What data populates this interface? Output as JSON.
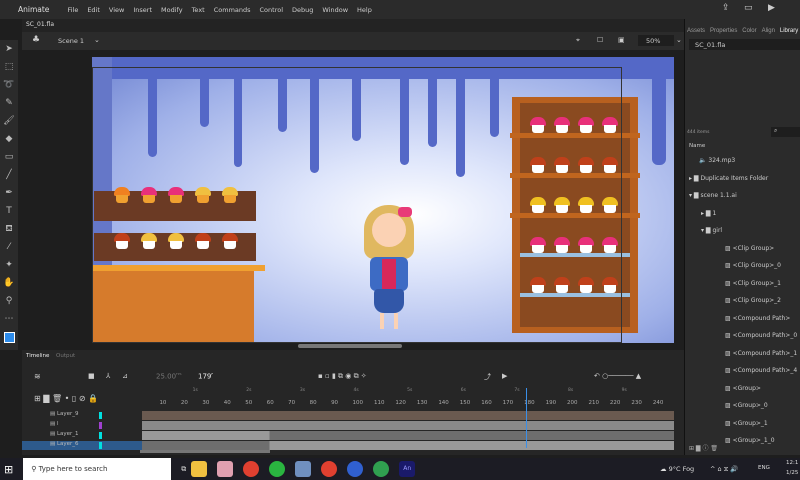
{
  "app": {
    "name": "Animate",
    "menu": [
      "File",
      "Edit",
      "View",
      "Insert",
      "Modify",
      "Text",
      "Commands",
      "Control",
      "Debug",
      "Window",
      "Help"
    ]
  },
  "document": {
    "tab": "SC_01.fla",
    "scene": "Scene 1",
    "zoom": "50%"
  },
  "right_panel": {
    "tabs": [
      "Assets",
      "Properties",
      "Color",
      "Align",
      "Library"
    ],
    "library_doc": "SC_01.fla",
    "item_count": "444 items",
    "name_header": "Name",
    "items": [
      {
        "label": "324.mp3",
        "depth": 0,
        "type": "sound"
      },
      {
        "label": "Duplicate Items Folder",
        "depth": 0,
        "type": "folder-collapsed"
      },
      {
        "label": "scene 1.1.ai",
        "depth": 0,
        "type": "folder-expanded"
      },
      {
        "label": "1",
        "depth": 1,
        "type": "folder-collapsed"
      },
      {
        "label": "girl",
        "depth": 1,
        "type": "folder-expanded"
      },
      {
        "label": "<Clip Group>",
        "depth": 2,
        "type": "graphic"
      },
      {
        "label": "<Clip Group>_0",
        "depth": 2,
        "type": "graphic"
      },
      {
        "label": "<Clip Group>_1",
        "depth": 2,
        "type": "graphic"
      },
      {
        "label": "<Clip Group>_2",
        "depth": 2,
        "type": "graphic"
      },
      {
        "label": "<Compound Path>",
        "depth": 2,
        "type": "graphic"
      },
      {
        "label": "<Compound Path>_0",
        "depth": 2,
        "type": "graphic"
      },
      {
        "label": "<Compound Path>_1",
        "depth": 2,
        "type": "graphic"
      },
      {
        "label": "<Compound Path>_4",
        "depth": 2,
        "type": "graphic"
      },
      {
        "label": "<Group>",
        "depth": 2,
        "type": "graphic"
      },
      {
        "label": "<Group>_0",
        "depth": 2,
        "type": "graphic"
      },
      {
        "label": "<Group>_1",
        "depth": 2,
        "type": "graphic"
      },
      {
        "label": "<Group>_1_0",
        "depth": 2,
        "type": "graphic"
      }
    ]
  },
  "timeline": {
    "tabs": [
      "Timeline",
      "Output"
    ],
    "fps": "25.00",
    "fps_unit": "FPS",
    "frame": "179",
    "frame_unit": "F",
    "seconds": [
      "1s",
      "2s",
      "3s",
      "4s",
      "5s",
      "6s",
      "7s",
      "8s",
      "9s"
    ],
    "frame_ticks": [
      "10",
      "20",
      "30",
      "40",
      "50",
      "60",
      "70",
      "80",
      "90",
      "100",
      "110",
      "120",
      "130",
      "140",
      "150",
      "160",
      "170",
      "180",
      "190",
      "200",
      "210",
      "220",
      "230",
      "240"
    ],
    "layers": [
      {
        "name": "Layer_9",
        "color": "#00e0e0"
      },
      {
        "name": "l",
        "color": "#a040d0"
      },
      {
        "name": "Layer_1",
        "color": "#00e0e0"
      },
      {
        "name": "Layer_6",
        "color": "#00e0e0",
        "selected": true
      }
    ],
    "playhead_frame": 179,
    "total_frames": 248
  },
  "taskbar": {
    "search_placeholder": "Type here to search",
    "weather": "9°C Fog",
    "lang": "ENG",
    "time": "12:1",
    "date": "1/25"
  },
  "colors": {
    "accent": "#2d8ceb",
    "stage_drip": "#5468c7",
    "shelf": "#c0651e",
    "playhead": "#3a8fe8"
  }
}
